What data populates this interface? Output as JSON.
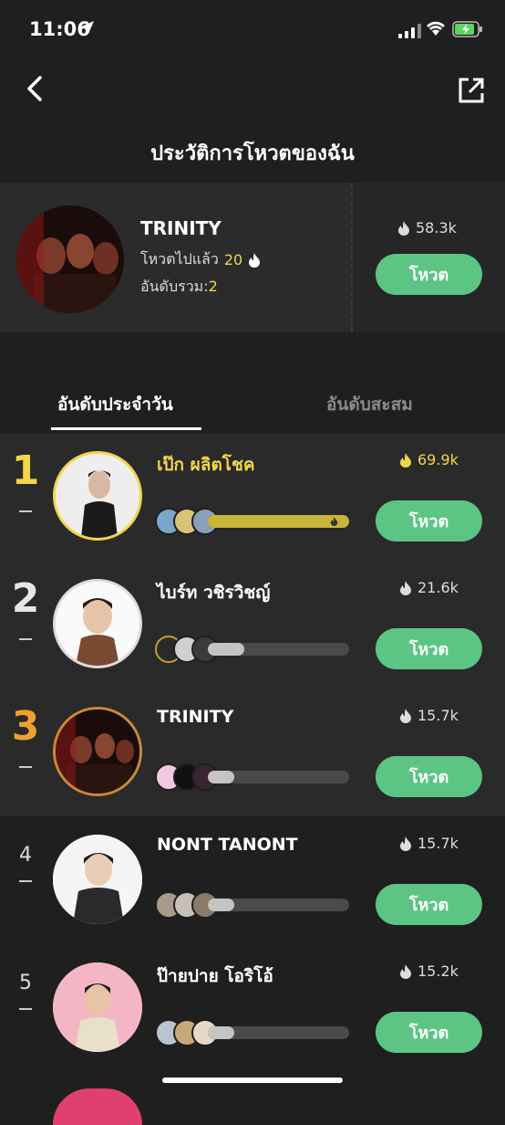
{
  "status": {
    "time": "11:06"
  },
  "header": {
    "title": "ประวัติการโหวตของฉัน"
  },
  "my_vote": {
    "name": "TRINITY",
    "voted_label": "โหวตไปแล้ว",
    "voted_count": "20",
    "rank_label": "อันดับรวม:",
    "rank_value": "2",
    "score": "58.3k",
    "vote_button": "โหวต"
  },
  "tabs": [
    {
      "label": "อันดับประจำวัน",
      "active": true
    },
    {
      "label": "อันดับสะสม",
      "active": false
    }
  ],
  "ranking": [
    {
      "rank": "1",
      "rank_color": "#f2d64b",
      "name": "เป๊ก ผลิตโชค",
      "name_color": "#f2d64b",
      "score": "69.9k",
      "score_color": "#f2d64b",
      "bar": 1.0,
      "bar_color": "#c9b43a",
      "ring": "#f2d64b",
      "vote_button": "โหวต"
    },
    {
      "rank": "2",
      "rank_color": "#e6e6e6",
      "name": "ไบร์ท วชิรวิชญ์",
      "name_color": "#ffffff",
      "score": "21.6k",
      "score_color": "#dddddd",
      "bar": 0.26,
      "bar_color": "#c4c4c4",
      "ring": "#dcdcdc",
      "vote_button": "โหวต"
    },
    {
      "rank": "3",
      "rank_color": "#f0a030",
      "name": "TRINITY",
      "name_color": "#ffffff",
      "score": "15.7k",
      "score_color": "#dddddd",
      "bar": 0.19,
      "bar_color": "#c4c4c4",
      "ring": "#c98a36",
      "vote_button": "โหวต"
    },
    {
      "rank": "4",
      "rank_color": "#dddddd",
      "name": "NONT TANONT",
      "name_color": "#ffffff",
      "score": "15.7k",
      "score_color": "#dddddd",
      "bar": 0.19,
      "bar_color": "#c4c4c4",
      "ring": "none",
      "vote_button": "โหวต"
    },
    {
      "rank": "5",
      "rank_color": "#dddddd",
      "name": "ป๊ายปาย โอริโอ้",
      "name_color": "#ffffff",
      "score": "15.2k",
      "score_color": "#dddddd",
      "bar": 0.19,
      "bar_color": "#c4c4c4",
      "ring": "none",
      "vote_button": "โหวต"
    }
  ],
  "colors": {
    "accent_green": "#5cc584",
    "gold": "#f2d64b",
    "bronze": "#f0a030"
  },
  "icons": [
    "back-arrow-icon",
    "share-icon",
    "flame-icon",
    "location-arrow-icon",
    "signal-icon",
    "wifi-icon",
    "battery-icon"
  ]
}
